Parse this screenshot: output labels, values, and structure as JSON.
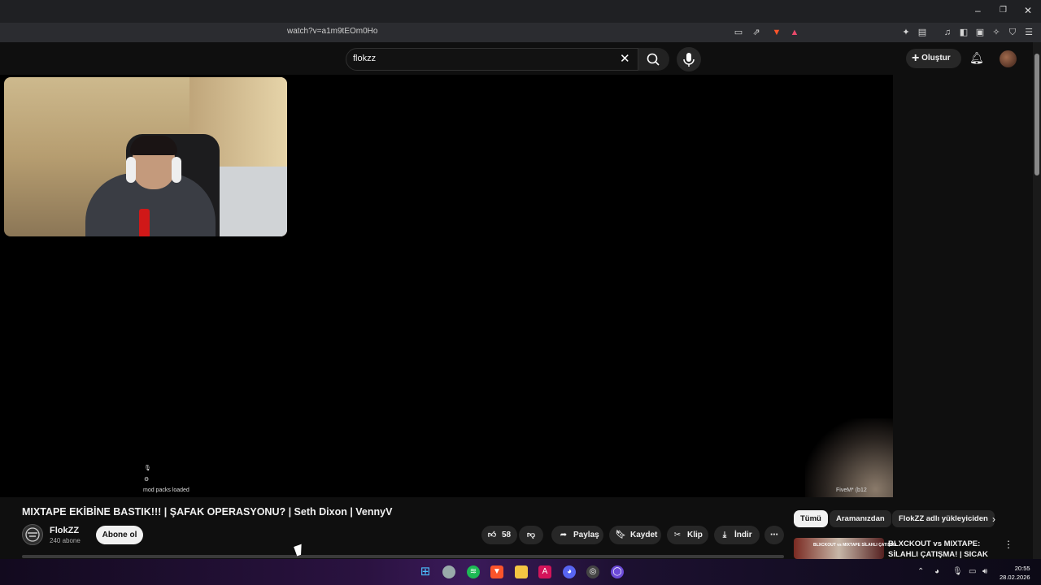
{
  "browser": {
    "url": "watch?v=a1m9tEOm0Ho",
    "window_controls": [
      "–",
      "❐",
      "✕"
    ],
    "right_icons": [
      "music-icon",
      "sidebar-icon",
      "wallet-icon",
      "leo-ai-icon",
      "vpn-icon",
      "menu-icon"
    ]
  },
  "youtube_header": {
    "search_value": "flokzz",
    "create_label": "Oluştur"
  },
  "player": {
    "overlay_line1": "mod packs loaded",
    "overlay_bottom_right": "FiveM* (b12"
  },
  "video": {
    "title": "MIXTAPE EKİBİNE BASTIK!!! | ŞAFAK OPERASYONU? | Seth Dixon | VennyV",
    "channel_name": "FlokZZ",
    "subscribers": "240 abone",
    "subscribe_label": "Abone ol",
    "likes": "58",
    "share_label": "Paylaş",
    "save_label": "Kaydet",
    "clip_label": "Klip",
    "download_label": "İndir"
  },
  "filter_chips": [
    "Tümü",
    "Aramanızdan",
    "FlokZZ adlı yükleyiciden"
  ],
  "recommendation": {
    "title": "BLXCKOUT vs MIXTAPE: SİLAHLI ÇATIŞMA! | SICAK ...",
    "thumb_text": "BLXCKOUT vs MIXTAPE SİLAHLI ÇATIŞMA"
  },
  "taskbar": {
    "time": "20:55",
    "date": "28.02.2026"
  }
}
